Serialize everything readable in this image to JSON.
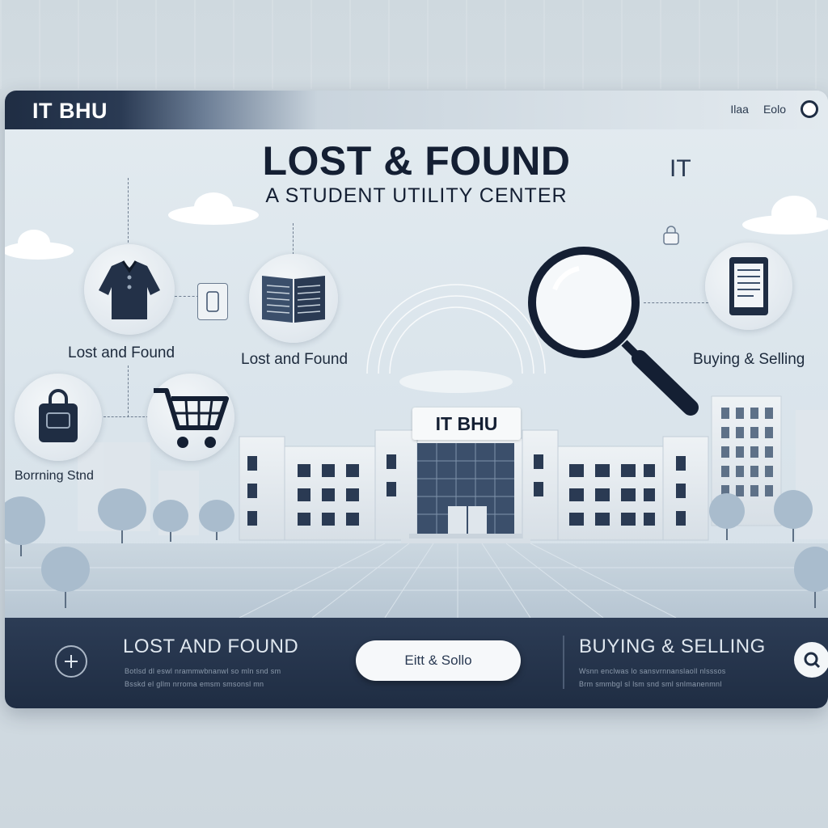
{
  "window": {
    "brand": "IT BHU",
    "nav": [
      "Ilaa",
      "Eolo"
    ]
  },
  "hero": {
    "title": "LOST & FOUND",
    "subtitle": "A STUDENT UTILITY CENTER",
    "side_mark": "IT"
  },
  "cards": {
    "lost_found_1": "Lost and Found",
    "lost_found_2": "Lost and Found",
    "buying_selling": "Buying & Selling",
    "borrowing": "Borrning Stnd"
  },
  "building": {
    "sign": "IT BHU"
  },
  "bottom": {
    "left_title": "LOST AND FOUND",
    "left_desc": "Botlsd dl eswl nrammwbnanwl so mln snd sm\nBsskd el gllm nrroma emsm smsonsl mn",
    "button_label": "Eitt & Sollo",
    "right_title": "BUYING & SELLING",
    "right_desc": "Wsnn enclwas lo sansvrnnanslaoll nlsssos\nBrm smmbgl sl lsm snd sml snlmanenmnl"
  },
  "colors": {
    "navy": "#1f2d43",
    "background": "#d8e1e7",
    "accent_light": "#f6f8fa"
  },
  "icons": [
    "shirt-icon",
    "book-icon",
    "bag-icon",
    "cart-icon",
    "magnifier-icon",
    "tablet-icon",
    "lock-icon",
    "phone-icon",
    "tool-icon",
    "search-icon",
    "user-icon"
  ]
}
